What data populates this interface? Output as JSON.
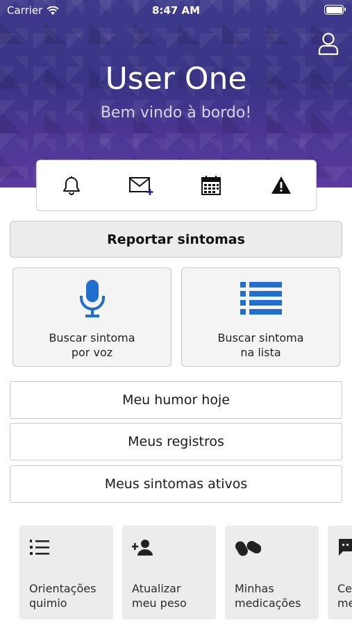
{
  "status_bar": {
    "carrier": "Carrier",
    "time": "8:47 AM"
  },
  "header": {
    "user_name": "User One",
    "welcome": "Bem vindo à bordo!"
  },
  "quick_actions": [
    {
      "icon": "bell-icon"
    },
    {
      "icon": "mail-add-icon"
    },
    {
      "icon": "calendar-icon"
    },
    {
      "icon": "warning-icon"
    }
  ],
  "report": {
    "label": "Reportar sintomas"
  },
  "search": {
    "voice_line1": "Buscar sintoma",
    "voice_line2": "por voz",
    "list_line1": "Buscar sintoma",
    "list_line2": "na lista"
  },
  "menu": {
    "humor": "Meu humor hoje",
    "registros": "Meus registros",
    "ativos": "Meus sintomas ativos"
  },
  "tiles": [
    {
      "label": "Orientações\nquimio",
      "icon": "numbered-list-icon"
    },
    {
      "label": "Atualizar\nmeu peso",
      "icon": "add-person-icon"
    },
    {
      "label": "Minhas\nmedicações",
      "icon": "pills-icon"
    },
    {
      "label": "Ce\nme",
      "icon": "chat-icon"
    }
  ],
  "colors": {
    "accent_blue": "#1f6fd1",
    "hero_purple": "#3d3a8c"
  }
}
